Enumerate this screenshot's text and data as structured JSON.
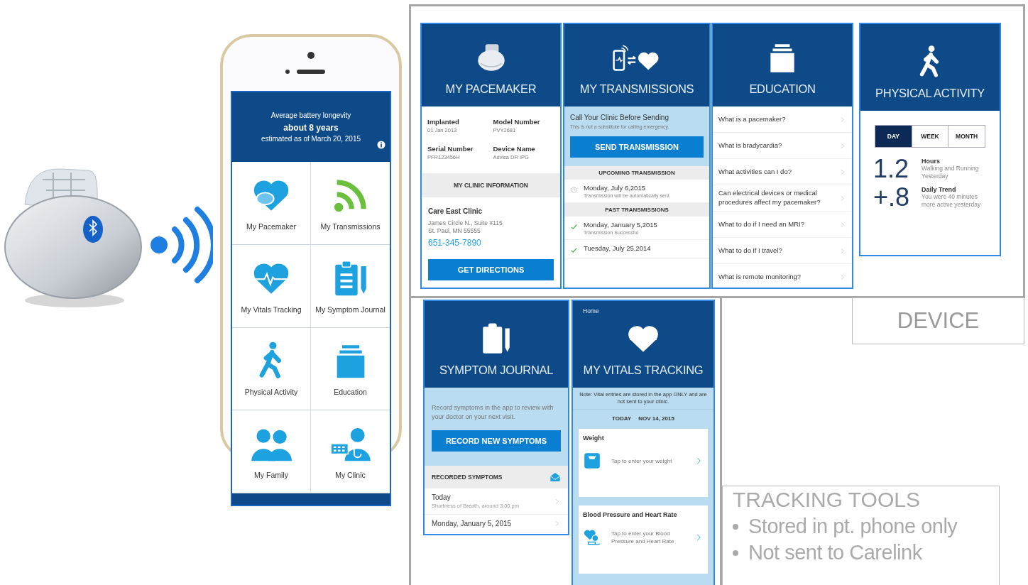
{
  "phone_app": {
    "header": {
      "line1": "Average battery longevity",
      "line2": "about 8 years",
      "line3": "estimated as of March 20, 2015"
    },
    "tiles": [
      {
        "label": "My Pacemaker"
      },
      {
        "label": "My Transmissions"
      },
      {
        "label": "My Vitals Tracking"
      },
      {
        "label": "My Symptom Journal"
      },
      {
        "label": "Physical Activity"
      },
      {
        "label": "Education"
      },
      {
        "label": "My Family"
      },
      {
        "label": "My Clinic"
      }
    ]
  },
  "device_group": {
    "label": "DEVICE",
    "pacemaker_screen": {
      "title": "MY PACEMAKER",
      "fields": [
        {
          "label": "Implanted",
          "value": "01 Jan 2013"
        },
        {
          "label": "Model Number",
          "value": "PVY2681"
        },
        {
          "label": "Serial Number",
          "value": "PFR123456H"
        },
        {
          "label": "Device Name",
          "value": "Advisa DR IPG"
        }
      ],
      "section_heading": "MY CLINIC INFORMATION",
      "clinic_name": "Care East Clinic",
      "address_lines": [
        "James Circle N., Suite #115",
        "St. Paul, MN 55555"
      ],
      "phone": "651-345-7890",
      "button": "GET DIRECTIONS"
    },
    "transmissions_screen": {
      "title": "MY TRANSMISSIONS",
      "notice_title": "Call Your Clinic Before Sending",
      "notice_text": "This is not a substitute for calling emergency.",
      "button": "SEND TRANSMISSION",
      "upcoming_heading": "UPCOMING TRANSMISSION",
      "upcoming": [
        {
          "date": "Monday, July 6,2015",
          "note": "Transmission will be automatically sent."
        }
      ],
      "past_heading": "PAST TRANSMISSIONS",
      "past": [
        {
          "date": "Monday, January 5,2015",
          "note": "Transmission Successful"
        },
        {
          "date": "Tuesday, July 25,2014"
        }
      ]
    },
    "education_screen": {
      "title": "EDUCATION",
      "items": [
        "What is a pacemaker?",
        "What is bradycardia?",
        "What activities can I do?",
        "Can electrical devices or medical procedures affect my pacemaker?",
        "What to do if I need an MRI?",
        "What to do if I travel?",
        "What is remote monitoring?"
      ]
    },
    "activity_screen": {
      "title": "PHYSICAL ACTIVITY",
      "tabs": [
        {
          "label": "DAY",
          "selected": true
        },
        {
          "label": "WEEK",
          "selected": false
        },
        {
          "label": "MONTH",
          "selected": false
        }
      ],
      "stats": [
        {
          "value": "1.2",
          "label": "Hours",
          "text": "Walking and Running Yesterday"
        },
        {
          "value": "+.8",
          "label": "Daily Trend",
          "text": "You were 40 minutes more active yesterday"
        }
      ]
    }
  },
  "tracking_group": {
    "title": "TRACKING TOOLS",
    "bullets": [
      "Stored in pt. phone only",
      "Not sent to Carelink"
    ],
    "symptom_screen": {
      "title": "SYMPTOM JOURNAL",
      "intro": "Record symptoms in the app to review with your doctor on your next visit.",
      "button": "RECORD NEW SYMPTOMS",
      "list_heading": "RECORDED SYMPTOMS",
      "entries": [
        {
          "date": "Today",
          "note": "Shortness of Breath, around 3:00 pm"
        },
        {
          "date": "Monday, January 5, 2015"
        }
      ]
    },
    "vitals_screen": {
      "breadcrumb": "Home",
      "title": "MY VITALS TRACKING",
      "note": "Note: Vital entries are stored in the app ONLY and are not sent to your clinic.",
      "date_label": "TODAY",
      "date": "NOV 14, 2015",
      "cards": [
        {
          "title": "Weight",
          "prompt": "Tap to enter your weight"
        },
        {
          "title": "Blood Pressure and Heart Rate",
          "prompt": "Tap to enter your Blood Pressure and Heart Rate"
        }
      ]
    }
  }
}
